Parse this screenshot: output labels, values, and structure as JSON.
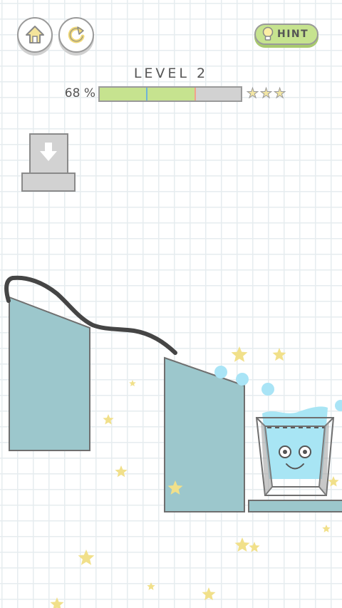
{
  "hud": {
    "home_icon": "home-icon",
    "restart_icon": "restart-icon",
    "hint_label": "HINT",
    "hint_icon": "lightbulb-icon"
  },
  "level": {
    "title": "LEVEL 2"
  },
  "progress": {
    "percent_label": "68 %",
    "fill_fraction": 0.68,
    "marker_fractions": [
      0.33,
      0.67
    ],
    "marker_colors": [
      "#6fb3d8",
      "#f0a38b"
    ],
    "stars_earned": 3,
    "star_icon": "star-icon"
  },
  "colors": {
    "block": "#9cc7cc",
    "outline": "#6f6f6f",
    "water": "#a8e5f4",
    "water_drop": "#a9e4f6",
    "star": "#f1e08a",
    "hint_bg": "#c6e38f",
    "bar_fill": "#c6e38f",
    "bar_empty": "#d2d2d2"
  },
  "scene": {
    "pen_icon": "arrow-down-icon",
    "glass_face": "smiling-glass-face"
  }
}
